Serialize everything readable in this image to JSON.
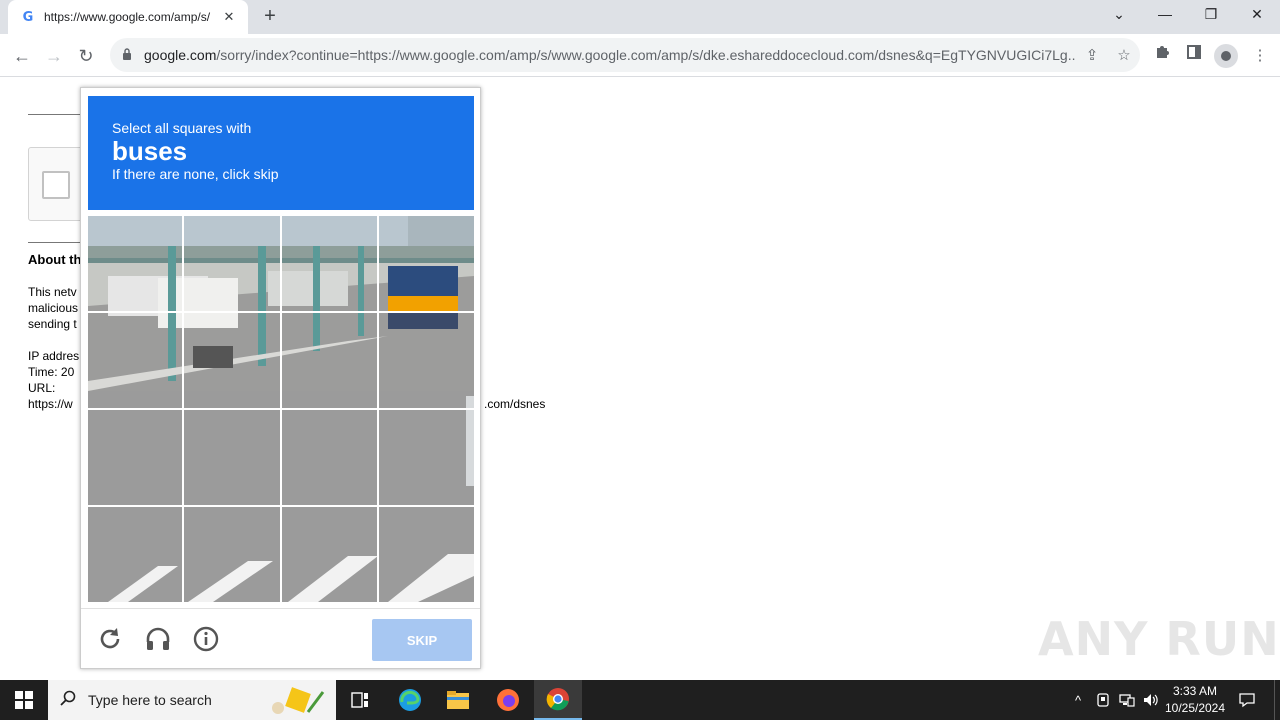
{
  "browser": {
    "tab_title": "https://www.google.com/amp/s/",
    "tab_close": "✕",
    "new_tab": "+",
    "url_host": "google.com",
    "url_rest": "/sorry/index?continue=https://www.google.com/amp/s/www.google.com/amp/s/dke.eshareddocecloud.com/dsnes&q=EgTYGNVUGICi7Lg..."
  },
  "page": {
    "about_heading": "About th",
    "para1": [
      "This netv",
      "malicious",
      "sending t"
    ],
    "ip_lines": [
      "IP addres",
      "Time: 20",
      "URL:",
      "https://w"
    ],
    "url_tail": ".com/dsnes"
  },
  "captcha": {
    "line1": "Select all squares with",
    "keyword": "buses",
    "line3": "If there are none, click skip",
    "skip_label": "SKIP",
    "header_color": "#1a73e8",
    "skip_color": "#a7c7f2"
  },
  "watermark": "ANY RUN",
  "taskbar": {
    "search_placeholder": "Type here to search",
    "time": "3:33 AM",
    "date": "10/25/2024"
  }
}
